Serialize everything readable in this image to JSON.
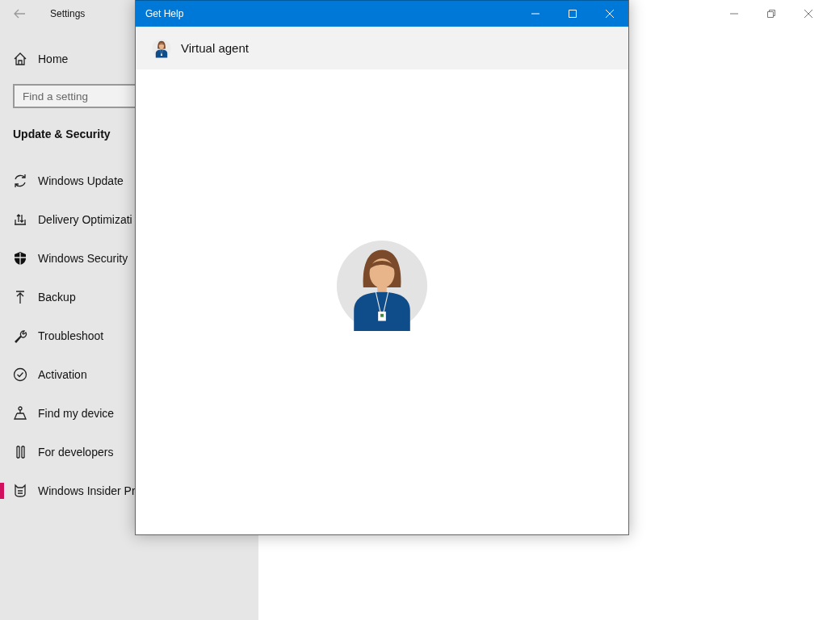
{
  "settings_window": {
    "title": "Settings",
    "home": "Home",
    "search": {
      "placeholder": "Find a setting"
    },
    "section_title": "Update & Security",
    "nav_items": [
      {
        "label": "Windows Update",
        "selected": false
      },
      {
        "label": "Delivery Optimizati",
        "selected": false
      },
      {
        "label": "Windows Security",
        "selected": false
      },
      {
        "label": "Backup",
        "selected": false
      },
      {
        "label": "Troubleshoot",
        "selected": false
      },
      {
        "label": "Activation",
        "selected": false
      },
      {
        "label": "Find my device",
        "selected": false
      },
      {
        "label": "For developers",
        "selected": false
      },
      {
        "label": "Windows Insider Pr",
        "selected": true
      }
    ]
  },
  "help_window": {
    "title": "Get Help",
    "header": "Virtual agent"
  }
}
